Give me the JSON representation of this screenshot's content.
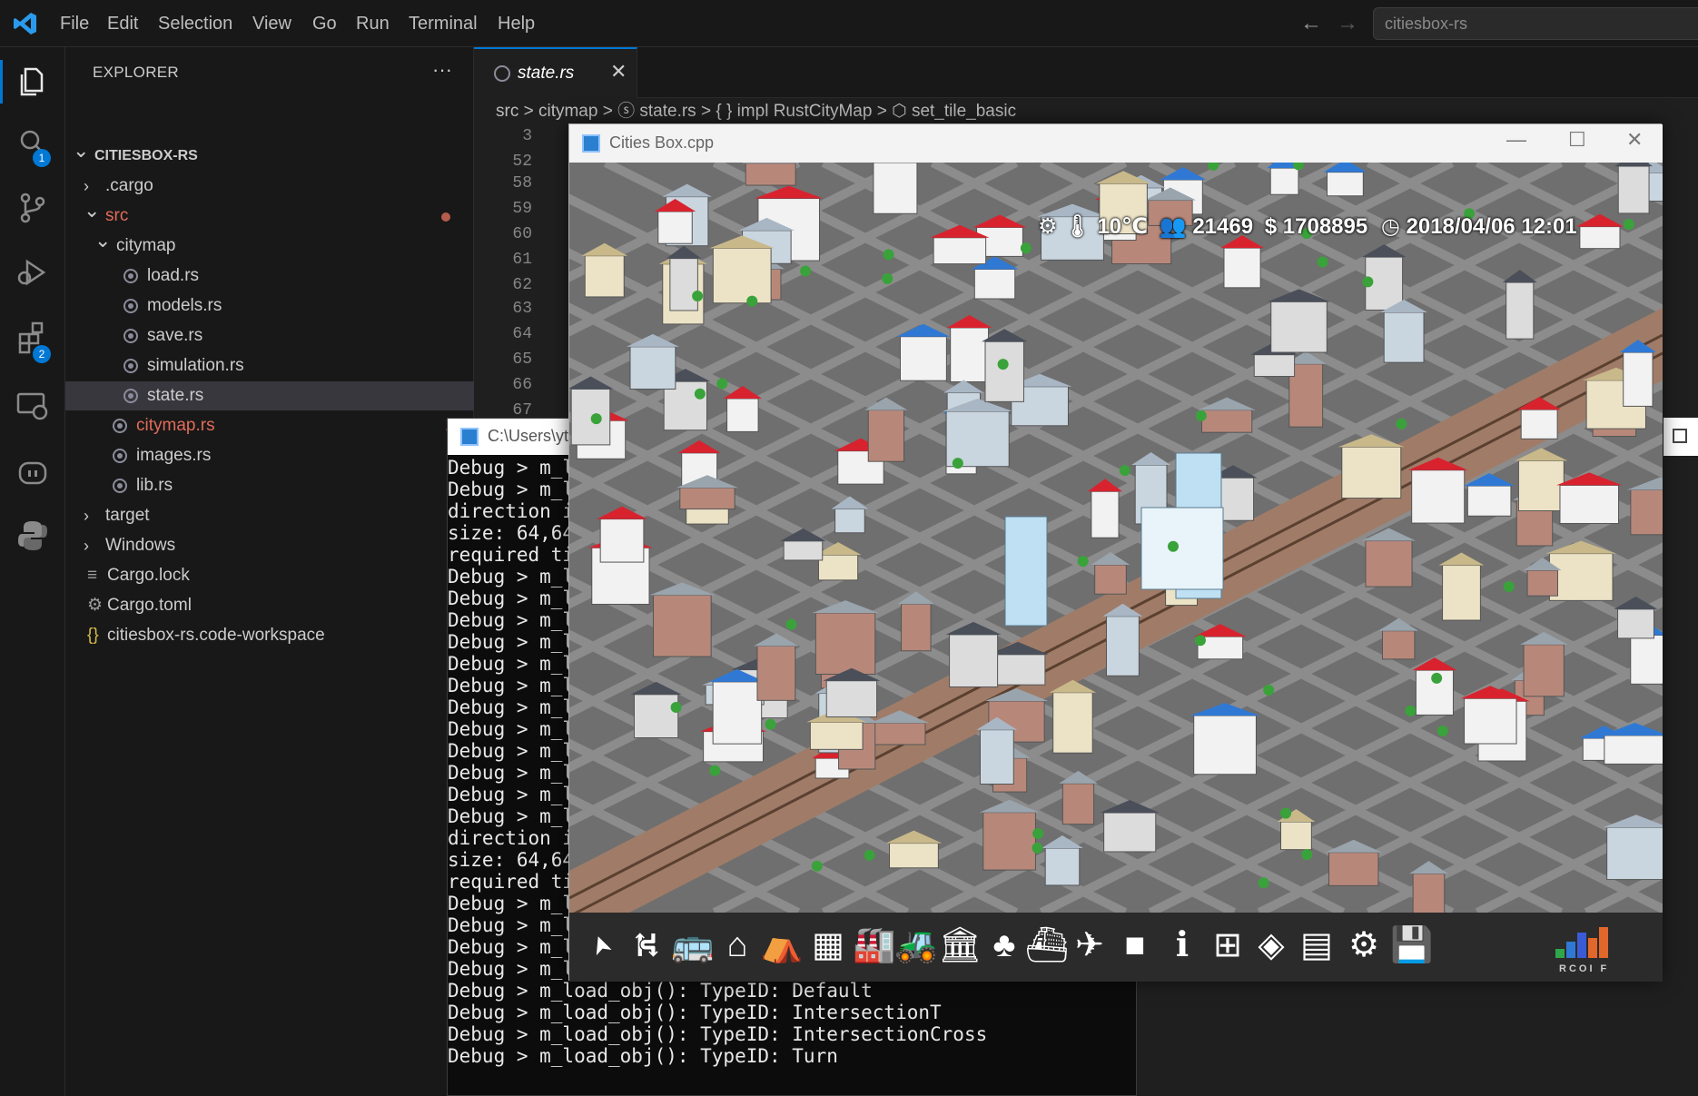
{
  "menubar": {
    "items": [
      "File",
      "Edit",
      "Selection",
      "View",
      "Go",
      "Run",
      "Terminal",
      "Help"
    ],
    "search_text": "citiesbox-rs",
    "back_icon": "arrow-left-icon",
    "forward_icon": "arrow-right-icon"
  },
  "activity": {
    "search_badge": "1",
    "extensions_badge": "2"
  },
  "explorer": {
    "title": "EXPLORER",
    "more": "···",
    "tree": [
      {
        "label": "CITIESBOX-RS",
        "chev": "v",
        "depth": 0,
        "bold": true
      },
      {
        "label": ".cargo",
        "chev": ">",
        "depth": 1
      },
      {
        "label": "src",
        "chev": "v",
        "depth": 1,
        "modified": true
      },
      {
        "label": "citymap",
        "chev": "v",
        "depth": 2
      },
      {
        "label": "load.rs",
        "depth": 3,
        "rust": true
      },
      {
        "label": "models.rs",
        "depth": 3,
        "rust": true
      },
      {
        "label": "save.rs",
        "depth": 3,
        "rust": true
      },
      {
        "label": "simulation.rs",
        "depth": 3,
        "rust": true
      },
      {
        "label": "state.rs",
        "depth": 3,
        "rust": true,
        "selected": true
      },
      {
        "label": "citymap.rs",
        "depth": 2,
        "rust": true,
        "error": "1"
      },
      {
        "label": "images.rs",
        "depth": 2,
        "rust": true
      },
      {
        "label": "lib.rs",
        "depth": 2,
        "rust": true
      },
      {
        "label": "target",
        "chev": ">",
        "depth": 1
      },
      {
        "label": "Windows",
        "chev": ">",
        "depth": 1
      },
      {
        "label": "Cargo.lock",
        "depth": 1,
        "icon": "≡"
      },
      {
        "label": "Cargo.toml",
        "depth": 1,
        "icon": "⚙"
      },
      {
        "label": "citiesbox-rs.code-workspace",
        "depth": 1,
        "icon": "{}"
      }
    ]
  },
  "editor": {
    "tab_label": "state.rs",
    "breadcrumb": "src  >  citymap  >  ⓢ state.rs  >  { } impl RustCityMap  >  ⬡ set_tile_basic",
    "line_numbers": [
      "3",
      "52",
      "58",
      "59",
      "60",
      "61",
      "62",
      "63",
      "64",
      "65",
      "66",
      "67"
    ]
  },
  "console": {
    "title": "C:\\Users\\yt",
    "lines": [
      "Debug > m_l",
      "Debug > m_l",
      "direction i",
      "size: 64,64",
      "required ti",
      "Debug > m_l",
      "Debug > m_l",
      "Debug > m_l",
      "Debug > m_l",
      "Debug > m_l",
      "Debug > m_l",
      "Debug > m_l",
      "Debug > m_l",
      "Debug > m_l",
      "Debug > m_l",
      "Debug > m_l",
      "Debug > m_l",
      "direction i",
      "size: 64,64",
      "required ti",
      "Debug > m_l",
      "Debug > m_l",
      "Debug > m_l",
      "Debug > m_load_obj(): TypeID: DeadEnd",
      "Debug > m_load_obj(): TypeID: Default",
      "Debug > m_load_obj(): TypeID: IntersectionT",
      "Debug > m_load_obj(): TypeID: IntersectionCross",
      "Debug > m_load_obj(): TypeID: Turn"
    ]
  },
  "game": {
    "title": "Cities Box.cpp",
    "hud": {
      "temperature": "10℃",
      "population": "21469",
      "money": "1708895",
      "datetime": "2018/04/06 12:01"
    },
    "logo_text": "RCOI F",
    "toolbar_icons": [
      "cursor-icon",
      "road-icon",
      "bus-icon",
      "house-icon",
      "shop-icon",
      "office-icon",
      "factory-icon",
      "tractor-icon",
      "museum-icon",
      "tree-icon",
      "ship-icon",
      "airplane-icon",
      "blank-tile-icon",
      "info-icon",
      "grid-icon",
      "eraser-icon",
      "card-icon",
      "settings-icon",
      "save-icon"
    ],
    "accent_colors": {
      "roof_red": "#d8232f",
      "roof_blue": "#2f79d4",
      "road": "#7a7a7a",
      "grass": "#3aa23a"
    }
  }
}
